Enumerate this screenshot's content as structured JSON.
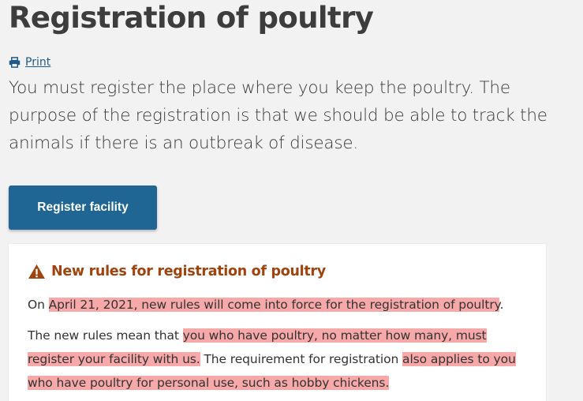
{
  "page": {
    "title": "Registration of poultry",
    "print_label": "Print",
    "intro": "You must register the place where you keep the poultry. The purpose of the registration is that we should be able to track the animals if there is an outbreak of disease.",
    "register_button": "Register facility"
  },
  "notice": {
    "icon": "warning-icon",
    "heading": "New rules for registration of poultry",
    "p1": {
      "before": "On ",
      "highlight": "April 21, 2021, new rules will come into force for the registration of poultry",
      "after": "."
    },
    "p2": {
      "before": "The new rules mean that ",
      "highlight1": "you who have poultry, no matter how many, must register your facility with us.",
      "middle": " The requirement for registration ",
      "highlight2": "also applies to you who have poultry for personal use, such as hobby chickens."
    }
  },
  "colors": {
    "button": "#1f6694",
    "link": "#1f5a8a",
    "notice_heading": "#a0430f",
    "highlight": "#f7a8a8"
  }
}
